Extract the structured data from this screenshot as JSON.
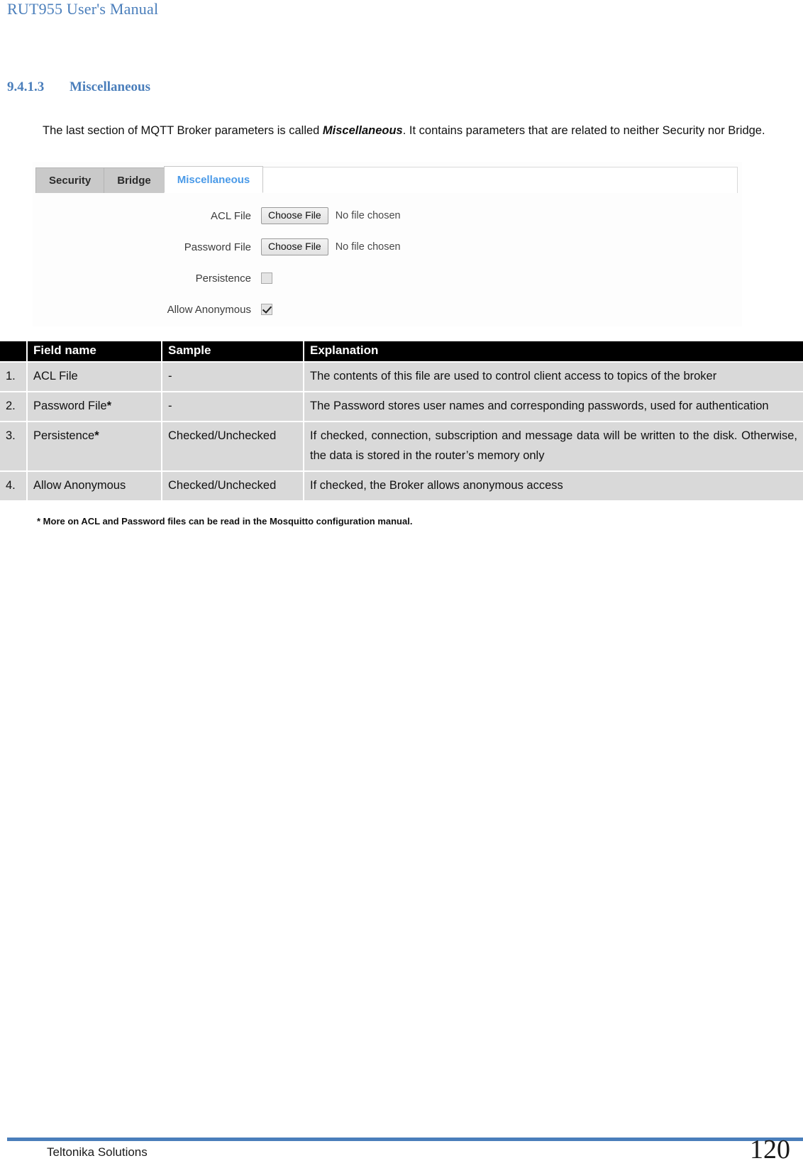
{
  "doc": {
    "running_header": "RUT955 User's Manual"
  },
  "section": {
    "number": "9.4.1.3",
    "title": "Miscellaneous",
    "paragraph_before": "The last section of MQTT Broker parameters is called ",
    "paragraph_emphasis": "Miscellaneous",
    "paragraph_after": ". It contains parameters that are related to neither Security nor Bridge."
  },
  "screenshot": {
    "tabs": [
      {
        "label": "Security",
        "active": false
      },
      {
        "label": "Bridge",
        "active": false
      },
      {
        "label": "Miscellaneous",
        "active": true
      }
    ],
    "fields": [
      {
        "label": "ACL File",
        "control": "file",
        "button": "Choose File",
        "status": "No file chosen"
      },
      {
        "label": "Password File",
        "control": "file",
        "button": "Choose File",
        "status": "No file chosen"
      },
      {
        "label": "Persistence",
        "control": "checkbox",
        "checked": false
      },
      {
        "label": "Allow Anonymous",
        "control": "checkbox",
        "checked": true
      }
    ]
  },
  "table": {
    "headers": [
      "",
      "Field name",
      "Sample",
      "Explanation"
    ],
    "rows": [
      {
        "num": "1.",
        "name": "ACL File",
        "name_bold": "",
        "sample": "-",
        "explanation": "The contents of this file are used to control client access to topics of the broker"
      },
      {
        "num": "2.",
        "name": "Password File",
        "name_bold": "*",
        "sample": "-",
        "explanation": "The Password stores user names and corresponding passwords, used for authentication"
      },
      {
        "num": "3.",
        "name": "Persistence",
        "name_bold": "*",
        "sample": "Checked/Unchecked",
        "explanation": "If checked, connection, subscription and message data will be written to the disk. Otherwise, the data is stored in the router’s memory only"
      },
      {
        "num": "4.",
        "name": "Allow Anonymous",
        "name_bold": "",
        "sample": "Checked/Unchecked",
        "explanation": "If checked, the Broker allows anonymous access"
      }
    ],
    "footnote": "* More on ACL and Password files can be read in the Mosquitto configuration manual."
  },
  "footer": {
    "company": "Teltonika Solutions",
    "page_number": "120"
  },
  "colors": {
    "accent_blue": "#4a7ebb",
    "tab_active_text": "#4a9ae8",
    "table_header_bg": "#000000",
    "table_cell_bg": "#d9d9d9"
  }
}
